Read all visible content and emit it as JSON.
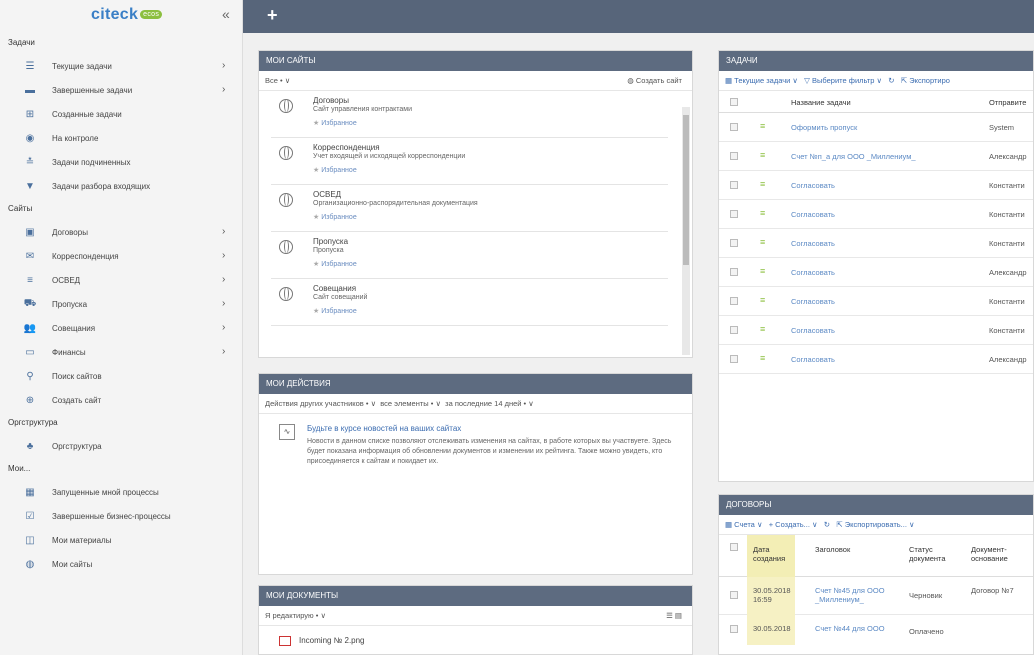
{
  "sidebar": {
    "logo": "citeck",
    "logo_badge": "ecos",
    "collapse": "«",
    "section_tasks": "Задачи",
    "tasks": [
      {
        "label": "Текущие задачи",
        "arrow": "›"
      },
      {
        "label": "Завершенные задачи",
        "arrow": "›"
      },
      {
        "label": "Созданные задачи"
      },
      {
        "label": "На контроле"
      },
      {
        "label": "Задачи подчиненных"
      },
      {
        "label": "Задачи разбора входящих"
      }
    ],
    "section_sites": "Сайты",
    "sites": [
      {
        "label": "Договоры",
        "arrow": "›"
      },
      {
        "label": "Корреспонденция",
        "arrow": "›"
      },
      {
        "label": "ОСВЕД",
        "arrow": "›"
      },
      {
        "label": "Пропуска",
        "arrow": "›"
      },
      {
        "label": "Совещания",
        "arrow": "›"
      },
      {
        "label": "Финансы",
        "arrow": "›"
      },
      {
        "label": "Поиск сайтов"
      },
      {
        "label": "Создать сайт"
      }
    ],
    "section_org": "Оргструктура",
    "org": [
      {
        "label": "Оргструктура"
      }
    ],
    "section_my": "Мои...",
    "my": [
      {
        "label": "Запущенные мной процессы"
      },
      {
        "label": "Завершенные бизнес-процессы"
      },
      {
        "label": "Мои материалы"
      },
      {
        "label": "Мои сайты"
      }
    ]
  },
  "topbar": {
    "plus": "+"
  },
  "my_sites": {
    "title": "Мои сайты",
    "filter": "Все • ∨",
    "create": "Создать сайт",
    "favorite": "Избранное",
    "items": [
      {
        "title": "Договоры",
        "desc": "Сайт управления контрактами"
      },
      {
        "title": "Корреспонденция",
        "desc": "Учет входящей и исходящей корреспонденции"
      },
      {
        "title": "ОСВЕД",
        "desc": "Организационно-распорядительная документация"
      },
      {
        "title": "Пропуска",
        "desc": "Пропуска"
      },
      {
        "title": "Совещания",
        "desc": "Сайт совещаний"
      }
    ]
  },
  "my_actions": {
    "title": "Мои действия",
    "filter1": "Действия других участников • ∨",
    "filter2": "все элементы • ∨",
    "filter3": "за последние 14 дней • ∨",
    "news_title": "Будьте в курсе новостей на ваших сайтах",
    "news_body": "Новости в данном списке позволяют отслеживать изменения на сайтах, в работе которых вы участвуете. Здесь будет показана информация об обновлении документов и изменении их рейтинга. Также можно увидеть, кто присоединяется к сайтам и покидает их."
  },
  "my_docs": {
    "title": "Мои документы",
    "filter": "Я редактирую • ∨",
    "first": "Incoming № 2.png"
  },
  "tasks_panel": {
    "title": "Задачи",
    "toolbar1": "Текущие задачи ∨",
    "toolbar2": "Выберите фильтр ∨",
    "toolbar3": "Экспортиро",
    "col_name": "Название задачи",
    "col_sender": "Отправите",
    "rows": [
      {
        "name": "Оформить пропуск",
        "sender": "System"
      },
      {
        "name": "Счет №п_а для ООО _Миллениум_",
        "sender": "Александр"
      },
      {
        "name": "Согласовать",
        "sender": "Константи"
      },
      {
        "name": "Согласовать",
        "sender": "Константи"
      },
      {
        "name": "Согласовать",
        "sender": "Константи"
      },
      {
        "name": "Согласовать",
        "sender": "Александр"
      },
      {
        "name": "Согласовать",
        "sender": "Константи"
      },
      {
        "name": "Согласовать",
        "sender": "Константи"
      },
      {
        "name": "Согласовать",
        "sender": "Александр"
      }
    ]
  },
  "contracts": {
    "title": "Договоры",
    "tool1": "Счета ∨",
    "tool2": "+ Создать... ∨",
    "tool3": "Экспортировать... ∨",
    "col_date": "Дата создания",
    "col_title": "Заголовок",
    "col_status": "Статус документа",
    "col_basis": "Документ-основание",
    "rows": [
      {
        "date": "30.05.2018 16:59",
        "title": "Счет №45 для ООО _Миллениум_",
        "status": "Черновик",
        "basis": "Договор №7"
      },
      {
        "date": "30.05.2018",
        "title": "Счет №44 для ООО",
        "status": "Оплачено",
        "basis": ""
      }
    ]
  }
}
